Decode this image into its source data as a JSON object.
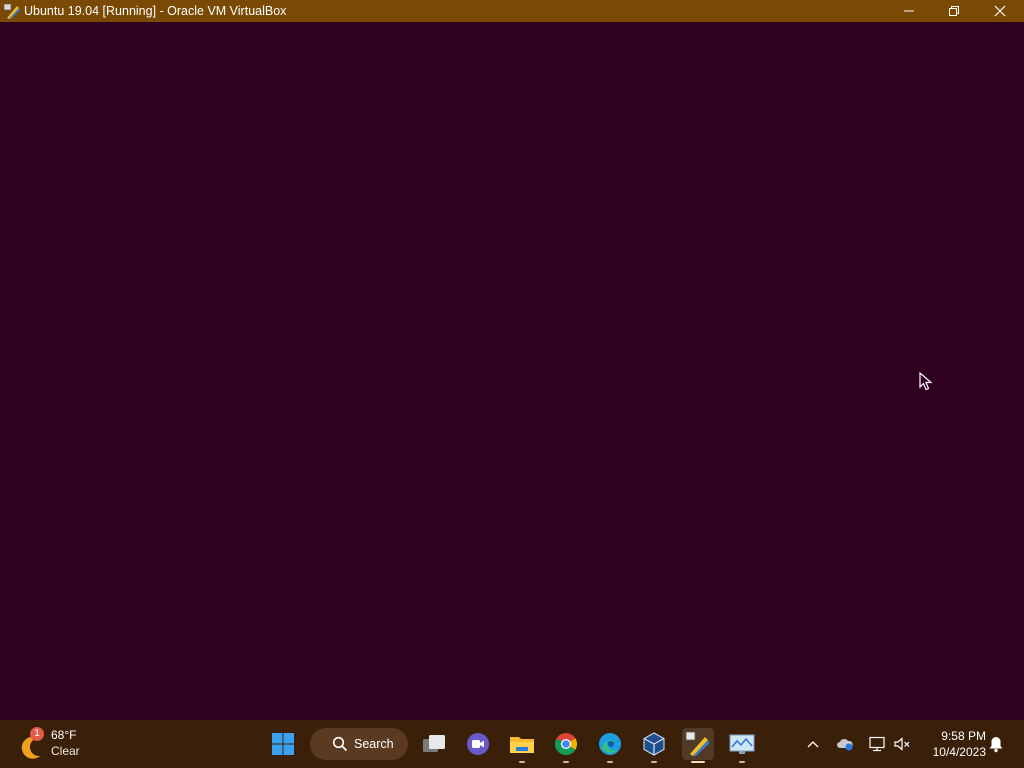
{
  "window": {
    "title": "Ubuntu 19.04 [Running] - Oracle VM VirtualBox",
    "app_icon": "virtualbox-vm-icon",
    "background": "#300020",
    "titlebar_color": "#7a4a04"
  },
  "taskbar": {
    "background": "#3a2008",
    "weather": {
      "temperature": "68°F",
      "condition": "Clear",
      "badge": "1",
      "icon": "moon-weather-icon"
    },
    "search": {
      "label": "Search"
    },
    "apps": [
      {
        "name": "start",
        "icon": "windows-start-icon"
      },
      {
        "name": "task-view",
        "icon": "task-view-icon"
      },
      {
        "name": "meet",
        "icon": "video-call-icon"
      },
      {
        "name": "file-explorer",
        "icon": "folder-icon",
        "running": true
      },
      {
        "name": "chrome",
        "icon": "chrome-icon",
        "running": true
      },
      {
        "name": "edge",
        "icon": "edge-icon",
        "running": true
      },
      {
        "name": "virtualbox",
        "icon": "virtualbox-icon",
        "running": true
      },
      {
        "name": "virtualbox-vm",
        "icon": "virtualbox-vm-icon",
        "running": true,
        "active": true
      },
      {
        "name": "performance-monitor",
        "icon": "monitor-chart-icon",
        "running": true
      }
    ],
    "tray": {
      "icons": [
        "chevron-up-icon",
        "onedrive-icon",
        "network-icon",
        "volume-muted-icon"
      ],
      "time": "9:58 PM",
      "date": "10/4/2023",
      "notification_icon": "bell-icon"
    }
  }
}
